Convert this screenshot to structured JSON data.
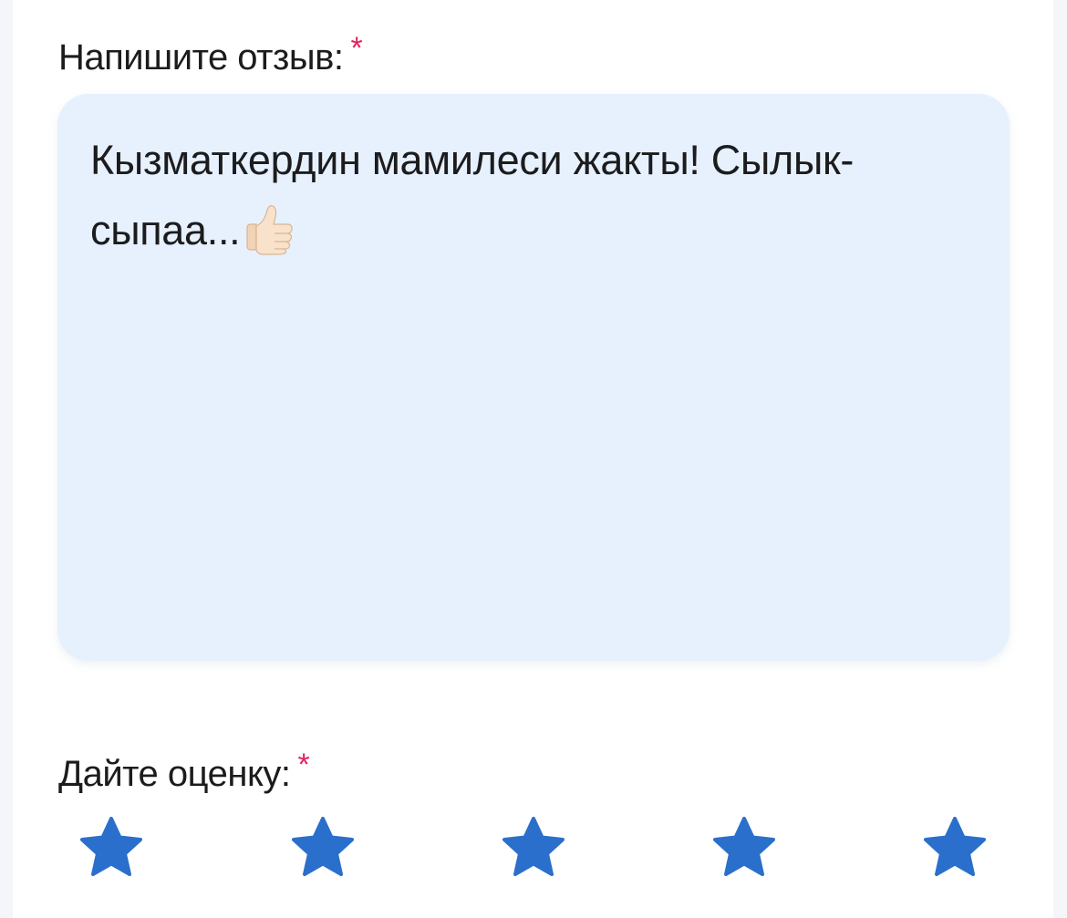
{
  "review": {
    "label": "Напишите отзыв:",
    "required_mark": "*",
    "text_line1": "Кызматкердин мамилеси жакты! Сылык-",
    "text_line2": "сыпаа...",
    "emoji_icon": "thumbs-up-icon"
  },
  "rating": {
    "label": "Дайте оценку:",
    "required_mark": "*",
    "max": 5,
    "star_icon": "star-icon"
  },
  "colors": {
    "star": "#2a6fcb",
    "required": "#e0245e",
    "input_bg": "#e7f1fe"
  }
}
